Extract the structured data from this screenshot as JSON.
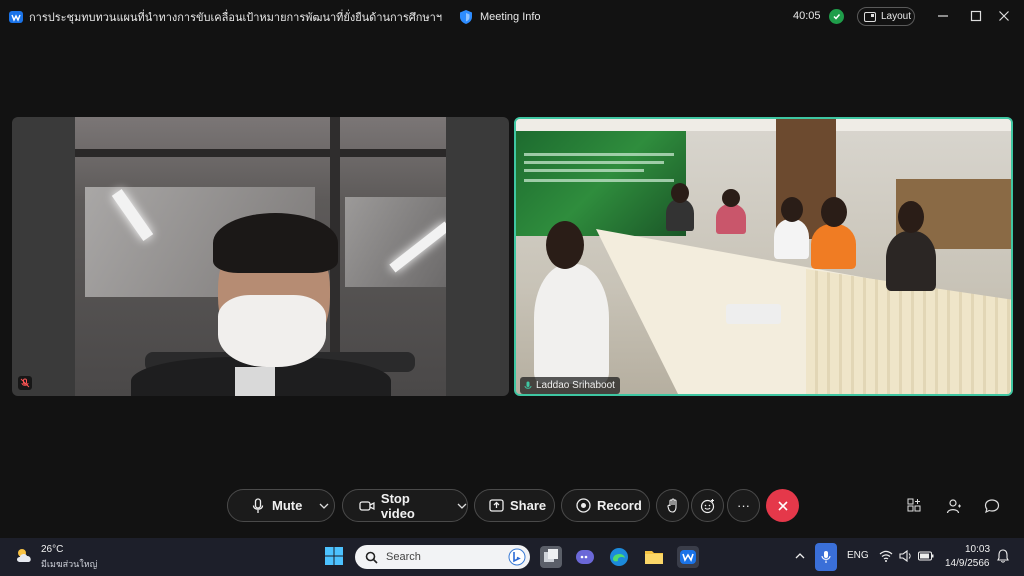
{
  "titlebar": {
    "meeting_title": "การประชุมทบทวนแผนที่นำทางการขับเคลื่อนเป้าหมายการพัฒนาที่ยั่งยืนด้านการศึกษาฯ",
    "meeting_info": "Meeting Info",
    "timer": "40:05",
    "layout_label": "Layout"
  },
  "participants": [
    {
      "name": "",
      "muted": true
    },
    {
      "name": "Laddao Srihaboot",
      "active_speaker": true
    }
  ],
  "controls": {
    "mute_label": "Mute",
    "stop_video_label": "Stop video",
    "share_label": "Share",
    "record_label": "Record",
    "more_label": "···"
  },
  "taskbar": {
    "temperature": "26°C",
    "weather_desc": "มีเมฆส่วนใหญ่",
    "search_placeholder": "Search",
    "language": "ENG",
    "time": "10:03",
    "date": "14/9/2566"
  },
  "colors": {
    "active_speaker_border": "#3fc6a2",
    "end_call": "#e5384a",
    "security_badge": "#1f9d4a"
  }
}
